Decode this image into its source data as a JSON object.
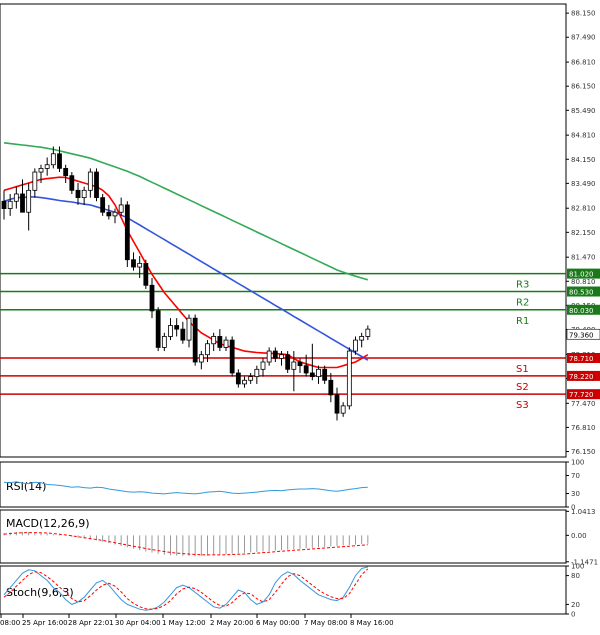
{
  "chart_data": {
    "type": "candlestick",
    "main": {
      "ylim": [
        76.0,
        88.4
      ],
      "price_ticks": [
        "88.150",
        "87.490",
        "86.810",
        "86.150",
        "85.490",
        "84.810",
        "84.150",
        "83.490",
        "82.810",
        "82.150",
        "81.470",
        "80.810",
        "80.150",
        "79.490",
        "78.810",
        "78.150",
        "77.470",
        "76.810",
        "76.150"
      ],
      "candles": [
        [
          83.0,
          83.3,
          82.5,
          82.8
        ],
        [
          82.8,
          83.2,
          82.6,
          83.0
        ],
        [
          83.0,
          83.4,
          82.8,
          83.2
        ],
        [
          83.2,
          83.6,
          82.9,
          82.7
        ],
        [
          82.7,
          83.5,
          82.2,
          83.3
        ],
        [
          83.3,
          83.9,
          83.1,
          83.8
        ],
        [
          83.8,
          84.0,
          83.5,
          83.9
        ],
        [
          83.9,
          84.2,
          83.7,
          84.0
        ],
        [
          84.0,
          84.5,
          83.9,
          84.3
        ],
        [
          84.3,
          84.5,
          83.8,
          83.9
        ],
        [
          83.9,
          84.0,
          83.5,
          83.7
        ],
        [
          83.7,
          83.8,
          83.2,
          83.3
        ],
        [
          83.3,
          83.5,
          82.9,
          83.1
        ],
        [
          83.1,
          83.4,
          82.9,
          83.3
        ],
        [
          83.3,
          83.9,
          83.1,
          83.8
        ],
        [
          83.8,
          83.9,
          83.0,
          83.1
        ],
        [
          83.1,
          83.2,
          82.6,
          82.7
        ],
        [
          82.7,
          82.9,
          82.5,
          82.6
        ],
        [
          82.6,
          82.8,
          82.4,
          82.7
        ],
        [
          82.7,
          83.1,
          82.6,
          82.9
        ],
        [
          82.9,
          83.0,
          81.2,
          81.4
        ],
        [
          81.4,
          81.6,
          81.1,
          81.2
        ],
        [
          81.2,
          81.5,
          80.9,
          81.3
        ],
        [
          81.3,
          81.4,
          80.6,
          80.7
        ],
        [
          80.7,
          80.9,
          79.8,
          80.0
        ],
        [
          80.0,
          80.1,
          78.9,
          79.0
        ],
        [
          79.0,
          79.4,
          78.9,
          79.3
        ],
        [
          79.3,
          79.8,
          79.2,
          79.6
        ],
        [
          79.6,
          79.8,
          79.3,
          79.5
        ],
        [
          79.5,
          79.7,
          79.1,
          79.2
        ],
        [
          79.2,
          79.9,
          79.0,
          79.8
        ],
        [
          79.8,
          79.9,
          78.5,
          78.6
        ],
        [
          78.6,
          78.9,
          78.4,
          78.8
        ],
        [
          78.8,
          79.2,
          78.6,
          79.1
        ],
        [
          79.1,
          79.4,
          78.9,
          79.3
        ],
        [
          79.3,
          79.5,
          78.9,
          79.0
        ],
        [
          79.0,
          79.3,
          78.9,
          79.2
        ],
        [
          79.2,
          79.3,
          78.2,
          78.3
        ],
        [
          78.3,
          78.4,
          77.9,
          78.0
        ],
        [
          78.0,
          78.2,
          77.9,
          78.1
        ],
        [
          78.1,
          78.3,
          78.0,
          78.2
        ],
        [
          78.2,
          78.5,
          78.0,
          78.4
        ],
        [
          78.4,
          78.7,
          78.2,
          78.6
        ],
        [
          78.6,
          79.0,
          78.5,
          78.9
        ],
        [
          78.9,
          79.0,
          78.6,
          78.7
        ],
        [
          78.7,
          78.9,
          78.5,
          78.8
        ],
        [
          78.8,
          78.9,
          78.3,
          78.4
        ],
        [
          78.4,
          78.9,
          77.8,
          78.6
        ],
        [
          78.6,
          78.7,
          78.3,
          78.5
        ],
        [
          78.5,
          78.8,
          78.2,
          78.3
        ],
        [
          78.3,
          79.1,
          78.1,
          78.2
        ],
        [
          78.2,
          78.5,
          78.0,
          78.4
        ],
        [
          78.4,
          78.5,
          78.0,
          78.1
        ],
        [
          78.1,
          78.3,
          77.5,
          77.7
        ],
        [
          77.7,
          77.9,
          77.0,
          77.2
        ],
        [
          77.2,
          77.5,
          77.1,
          77.4
        ],
        [
          77.4,
          79.0,
          77.3,
          78.9
        ],
        [
          78.9,
          79.3,
          78.8,
          79.2
        ],
        [
          79.2,
          79.4,
          79.0,
          79.3
        ],
        [
          79.3,
          79.6,
          79.2,
          79.5
        ]
      ],
      "ma_red": [
        83.3,
        83.35,
        83.4,
        83.45,
        83.5,
        83.55,
        83.6,
        83.62,
        83.64,
        83.66,
        83.65,
        83.6,
        83.55,
        83.5,
        83.45,
        83.4,
        83.3,
        83.15,
        82.9,
        82.55,
        82.2,
        81.9,
        81.6,
        81.3,
        81.0,
        80.75,
        80.5,
        80.3,
        80.1,
        79.9,
        79.7,
        79.55,
        79.4,
        79.3,
        79.2,
        79.1,
        79.05,
        79.0,
        78.95,
        78.9,
        78.88,
        78.86,
        78.85,
        78.84,
        78.83,
        78.82,
        78.8,
        78.7,
        78.6,
        78.55,
        78.5,
        78.45,
        78.45,
        78.45,
        78.45,
        78.5,
        78.55,
        78.6,
        78.7,
        78.8
      ],
      "ma_blue": [
        83.0,
        83.05,
        83.1,
        83.1,
        83.12,
        83.12,
        83.1,
        83.08,
        83.05,
        83.02,
        83.0,
        82.98,
        82.95,
        82.92,
        82.9,
        82.85,
        82.8,
        82.75,
        82.7,
        82.62,
        82.55,
        82.45,
        82.35,
        82.25,
        82.15,
        82.05,
        81.95,
        81.85,
        81.75,
        81.65,
        81.55,
        81.45,
        81.35,
        81.25,
        81.15,
        81.05,
        80.95,
        80.85,
        80.75,
        80.65,
        80.55,
        80.45,
        80.35,
        80.25,
        80.15,
        80.05,
        79.95,
        79.85,
        79.75,
        79.65,
        79.55,
        79.45,
        79.35,
        79.25,
        79.15,
        79.05,
        78.95,
        78.85,
        78.75,
        78.65
      ],
      "ma_green": [
        84.6,
        84.58,
        84.56,
        84.54,
        84.52,
        84.5,
        84.48,
        84.45,
        84.42,
        84.38,
        84.34,
        84.3,
        84.26,
        84.22,
        84.18,
        84.12,
        84.06,
        84.0,
        83.94,
        83.88,
        83.82,
        83.75,
        83.68,
        83.6,
        83.52,
        83.44,
        83.36,
        83.28,
        83.2,
        83.12,
        83.04,
        82.96,
        82.88,
        82.8,
        82.72,
        82.64,
        82.56,
        82.48,
        82.4,
        82.32,
        82.24,
        82.16,
        82.08,
        82.0,
        81.92,
        81.84,
        81.76,
        81.68,
        81.6,
        81.52,
        81.44,
        81.36,
        81.28,
        81.2,
        81.12,
        81.06,
        81.0,
        80.95,
        80.9,
        80.85
      ],
      "levels": [
        {
          "name": "R3",
          "value": 81.02,
          "label": "81.020",
          "color": "#1a7a1a"
        },
        {
          "name": "R2",
          "value": 80.53,
          "label": "80.530",
          "color": "#1a7a1a"
        },
        {
          "name": "R1",
          "value": 80.03,
          "label": "80.030",
          "color": "#1a7a1a"
        },
        {
          "name": "S1",
          "value": 78.71,
          "label": "78.710",
          "color": "#cc0000"
        },
        {
          "name": "S2",
          "value": 78.22,
          "label": "78.220",
          "color": "#cc0000"
        },
        {
          "name": "S3",
          "value": 77.72,
          "label": "77.720",
          "color": "#cc0000"
        }
      ],
      "current_price": "79.360",
      "current_value": 79.36
    },
    "rsi": {
      "title": "RSI(14)",
      "ticks": [
        "100",
        "70",
        "30",
        "0"
      ],
      "values": [
        55,
        54,
        56,
        53,
        52,
        55,
        54,
        50,
        49,
        48,
        46,
        44,
        45,
        43,
        42,
        44,
        43,
        40,
        38,
        36,
        34,
        33,
        34,
        33,
        31,
        30,
        29,
        31,
        32,
        31,
        30,
        29,
        31,
        33,
        34,
        35,
        33,
        31,
        30,
        31,
        32,
        33,
        35,
        36,
        37,
        36,
        38,
        39,
        40,
        40,
        41,
        40,
        38,
        36,
        35,
        37,
        39,
        41,
        43,
        44
      ]
    },
    "macd": {
      "title": "MACD(12,26,9)",
      "ticks": [
        "1.0413",
        "0.00",
        "-1.1471"
      ],
      "ylim": [
        -1.2,
        1.1
      ],
      "hist": [
        0.1,
        0.12,
        0.14,
        0.15,
        0.14,
        0.12,
        0.1,
        0.08,
        0.05,
        0.02,
        -0.02,
        -0.06,
        -0.1,
        -0.14,
        -0.18,
        -0.22,
        -0.28,
        -0.34,
        -0.4,
        -0.46,
        -0.52,
        -0.58,
        -0.64,
        -0.7,
        -0.75,
        -0.8,
        -0.84,
        -0.87,
        -0.88,
        -0.89,
        -0.9,
        -0.9,
        -0.89,
        -0.88,
        -0.86,
        -0.84,
        -0.82,
        -0.8,
        -0.78,
        -0.76,
        -0.74,
        -0.72,
        -0.7,
        -0.68,
        -0.66,
        -0.64,
        -0.62,
        -0.6,
        -0.58,
        -0.56,
        -0.54,
        -0.52,
        -0.5,
        -0.48,
        -0.46,
        -0.44,
        -0.42,
        -0.4,
        -0.38,
        -0.36
      ],
      "signal": [
        0.05,
        0.08,
        0.1,
        0.11,
        0.12,
        0.12,
        0.11,
        0.1,
        0.08,
        0.05,
        0.02,
        -0.02,
        -0.06,
        -0.1,
        -0.14,
        -0.18,
        -0.22,
        -0.27,
        -0.32,
        -0.37,
        -0.42,
        -0.47,
        -0.52,
        -0.57,
        -0.62,
        -0.66,
        -0.7,
        -0.74,
        -0.77,
        -0.79,
        -0.81,
        -0.83,
        -0.84,
        -0.85,
        -0.85,
        -0.85,
        -0.84,
        -0.83,
        -0.82,
        -0.81,
        -0.79,
        -0.77,
        -0.75,
        -0.73,
        -0.71,
        -0.69,
        -0.67,
        -0.65,
        -0.63,
        -0.61,
        -0.59,
        -0.57,
        -0.55,
        -0.53,
        -0.51,
        -0.49,
        -0.47,
        -0.45,
        -0.43,
        -0.41
      ]
    },
    "stoch": {
      "title": "Stoch(9,6,3)",
      "ticks": [
        "100",
        "80",
        "20",
        "0"
      ],
      "k": [
        40,
        55,
        70,
        85,
        92,
        90,
        80,
        70,
        55,
        45,
        30,
        20,
        25,
        35,
        50,
        65,
        70,
        60,
        45,
        30,
        20,
        15,
        10,
        8,
        10,
        15,
        25,
        40,
        55,
        60,
        55,
        45,
        35,
        25,
        15,
        12,
        20,
        35,
        50,
        45,
        30,
        20,
        25,
        40,
        65,
        80,
        88,
        82,
        70,
        60,
        50,
        40,
        35,
        30,
        28,
        35,
        55,
        80,
        95,
        98
      ],
      "d": [
        35,
        45,
        58,
        70,
        82,
        88,
        86,
        78,
        68,
        56,
        45,
        32,
        25,
        28,
        38,
        50,
        60,
        64,
        58,
        46,
        32,
        22,
        15,
        11,
        10,
        12,
        18,
        28,
        42,
        52,
        56,
        53,
        45,
        35,
        25,
        18,
        16,
        24,
        36,
        44,
        42,
        32,
        25,
        30,
        45,
        62,
        78,
        84,
        80,
        70,
        60,
        50,
        42,
        36,
        32,
        32,
        42,
        62,
        82,
        94
      ]
    },
    "x_ticks": [
      "08:00",
      "25 Apr 16:00",
      "28 Apr 22:01",
      "30 Apr 04:00",
      "1 May 12:00",
      "2 May 20:00",
      "6 May 00:00",
      "7 May 08:00",
      "8 May 16:00"
    ],
    "colors": {
      "up": "#1a7a1a",
      "down": "#cc0000",
      "ma_red": "#ff0000",
      "ma_blue": "#3355dd",
      "ma_green": "#33aa55",
      "rsi": "#3399dd",
      "macd_hist": "#999999",
      "macd_signal": "#ff0000",
      "stoch_k": "#3399dd",
      "stoch_d": "#ff0000"
    }
  }
}
